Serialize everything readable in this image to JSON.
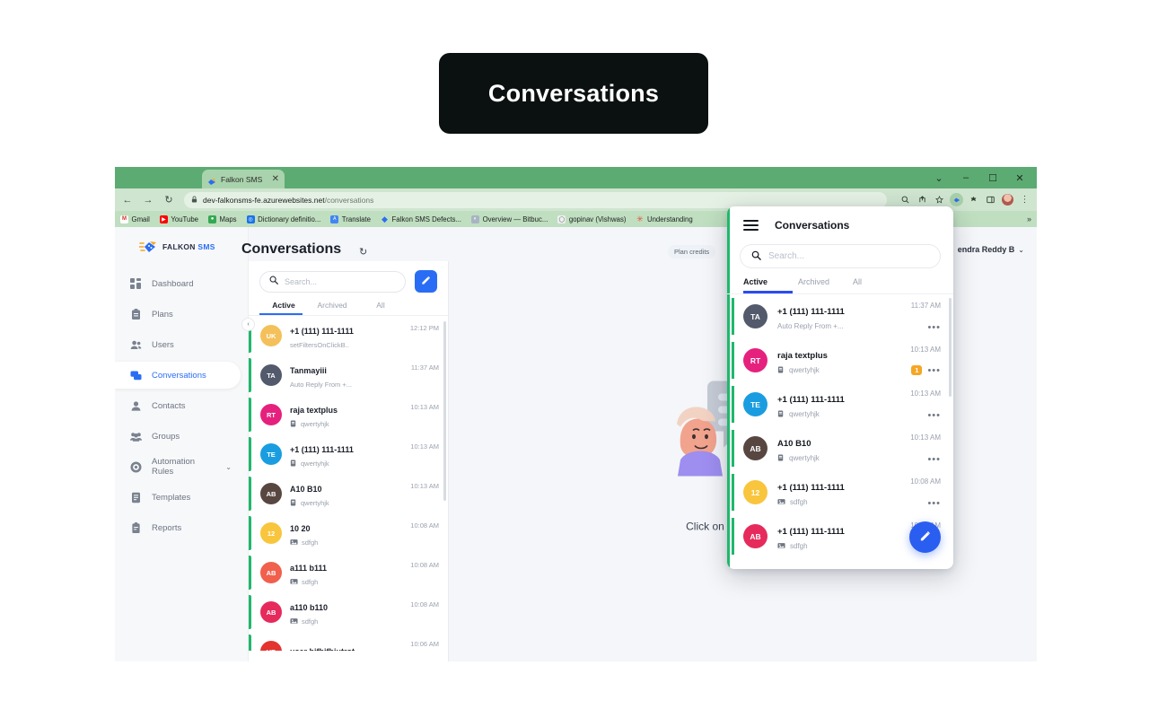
{
  "title_card": {
    "label": "Conversations"
  },
  "browser": {
    "tab": {
      "title": "Falkon SMS",
      "favicon": "falkon-logo-icon",
      "close": "✕"
    },
    "window_controls": [
      "⌄",
      "–",
      "☐",
      "✕"
    ],
    "nav": {
      "back": "←",
      "forward": "→",
      "reload": "↻"
    },
    "omnibox": {
      "lock": "🔒",
      "host": "dev-falkonsms-fe.azurewebsites.net",
      "path": "/conversations"
    },
    "toolbar_icons": [
      "search-icon",
      "share-icon",
      "star-icon",
      "falkon-extension-icon",
      "extensions-icon",
      "sidepanel-icon",
      "profile-avatar",
      "more-menu-icon"
    ],
    "bookmarks": [
      {
        "label": "Gmail",
        "color": "#d93025",
        "glyph": "M"
      },
      {
        "label": "YouTube",
        "color": "#ff0000",
        "glyph": "▶"
      },
      {
        "label": "Maps",
        "color": "#34a853",
        "glyph": "●"
      },
      {
        "label": "Dictionary definitio...",
        "color": "#1a73e8",
        "glyph": "◎"
      },
      {
        "label": "Translate",
        "color": "#4285f4",
        "glyph": "文"
      },
      {
        "label": "Falkon SMS Defects...",
        "color": "#2a6df5",
        "glyph": "◆"
      },
      {
        "label": "Overview — Bitbuc...",
        "color": "#a9b4c2",
        "glyph": "◔"
      },
      {
        "label": "gopinav (Vishwas)",
        "color": "#d7dbe2",
        "glyph": "◯"
      },
      {
        "label": "Understanding",
        "color": "#e8503a",
        "glyph": "✳"
      }
    ],
    "bookmarks_overflow": "»"
  },
  "app": {
    "logo": {
      "name": "FALKON",
      "suffix": "SMS"
    },
    "collapse_button": "‹",
    "sidebar": {
      "items": [
        {
          "label": "Dashboard",
          "icon": "dashboard-icon",
          "active": false
        },
        {
          "label": "Plans",
          "icon": "clipboard-icon",
          "active": false
        },
        {
          "label": "Users",
          "icon": "users-icon",
          "active": false
        },
        {
          "label": "Conversations",
          "icon": "chat-bubbles-icon",
          "active": true
        },
        {
          "label": "Contacts",
          "icon": "person-icon",
          "active": false
        },
        {
          "label": "Groups",
          "icon": "group-icon",
          "active": false
        },
        {
          "label": "Automation Rules",
          "icon": "gear-circle-icon",
          "active": false,
          "chevron": "⌄"
        },
        {
          "label": "Templates",
          "icon": "template-icon",
          "active": false
        },
        {
          "label": "Reports",
          "icon": "report-icon",
          "active": false
        }
      ]
    },
    "header": {
      "page_title": "Conversations",
      "refresh_icon": "↻",
      "plan_credits": "Plan credits",
      "user_name": "endra Reddy B",
      "user_chevron": "⌄"
    },
    "conversation_panel": {
      "search_placeholder": "Search...",
      "search_icon": "search-icon",
      "compose_icon": "compose-icon",
      "tabs": [
        {
          "label": "Active",
          "active": true
        },
        {
          "label": "Archived",
          "active": false
        },
        {
          "label": "All",
          "active": false
        }
      ],
      "rows": [
        {
          "initials": "UK",
          "color": "#f4c05a",
          "name": "+1 (111) 111-1111",
          "preview": "setFiltersOnClickB..",
          "attachment": "",
          "time": "12:12 PM"
        },
        {
          "initials": "TA",
          "color": "#525a6b",
          "name": "Tanmayiii",
          "preview": "Auto Reply From +...",
          "attachment": "",
          "time": "11:37 AM"
        },
        {
          "initials": "RT",
          "color": "#e5217d",
          "name": "raja textplus",
          "preview": "qwertyhjk",
          "attachment": "file-icon",
          "time": "10:13 AM"
        },
        {
          "initials": "TE",
          "color": "#1a9de0",
          "name": "+1 (111) 111-1111",
          "preview": "qwertyhjk",
          "attachment": "file-icon",
          "time": "10:13 AM"
        },
        {
          "initials": "AB",
          "color": "#584741",
          "name": "A10 B10",
          "preview": "qwertyhjk",
          "attachment": "file-icon",
          "time": "10:13 AM"
        },
        {
          "initials": "12",
          "color": "#f8c53d",
          "name": "10 20",
          "preview": "sdfgh",
          "attachment": "image-icon",
          "time": "10:08 AM"
        },
        {
          "initials": "AB",
          "color": "#f0604d",
          "name": "a111 b111",
          "preview": "sdfgh",
          "attachment": "image-icon",
          "time": "10:08 AM"
        },
        {
          "initials": "AB",
          "color": "#e62a5c",
          "name": "a110 b110",
          "preview": "sdfgh",
          "attachment": "image-icon",
          "time": "10:08 AM"
        },
        {
          "initials": "UB",
          "color": "#e3342f",
          "name": "user bifbifbiutrot",
          "preview": "",
          "attachment": "",
          "time": "10:06 AM"
        }
      ]
    },
    "empty_state": {
      "caption": "Click on a Conversation",
      "illustration": "chat-illustration"
    }
  },
  "popup": {
    "menu_icon": "hamburger-icon",
    "title": "Conversations",
    "search_placeholder": "Search...",
    "search_icon": "search-icon",
    "tabs": [
      {
        "label": "Active",
        "active": true
      },
      {
        "label": "Archived",
        "active": false
      },
      {
        "label": "All",
        "active": false
      }
    ],
    "rows": [
      {
        "initials": "TA",
        "color": "#525a6b",
        "name": "+1 (111) 111-1111",
        "preview": "Auto Reply From  +...",
        "attachment": "",
        "time": "11:37 AM",
        "badge": "",
        "dots": "•••"
      },
      {
        "initials": "RT",
        "color": "#e5217d",
        "name": "raja textplus",
        "preview": "qwertyhjk",
        "attachment": "file-icon",
        "time": "10:13 AM",
        "badge": "1",
        "dots": "•••"
      },
      {
        "initials": "TE",
        "color": "#1a9de0",
        "name": "+1 (111) 111-1111",
        "preview": "qwertyhjk",
        "attachment": "file-icon",
        "time": "10:13 AM",
        "badge": "",
        "dots": "•••"
      },
      {
        "initials": "AB",
        "color": "#584741",
        "name": "A10 B10",
        "preview": "qwertyhjk",
        "attachment": "file-icon",
        "time": "10:13 AM",
        "badge": "",
        "dots": "•••"
      },
      {
        "initials": "12",
        "color": "#f8c53d",
        "name": "+1 (111) 111-1111",
        "preview": "sdfgh",
        "attachment": "image-icon",
        "time": "10:08 AM",
        "badge": "",
        "dots": "•••"
      },
      {
        "initials": "AB",
        "color": "#e62a5c",
        "name": "+1 (111) 111-1111",
        "preview": "sdfgh",
        "attachment": "image-icon",
        "time": "10:08 AM",
        "badge": "",
        "dots": ""
      }
    ],
    "fab_icon": "compose-icon"
  },
  "colors": {
    "accent_blue": "#2a6df5",
    "popup_accent": "#2a4cf0",
    "green_bar": "#1fb86b",
    "badge_orange": "#f5a623",
    "browser_chrome": "#5cab73",
    "page_bg": "#f4f6f9"
  }
}
